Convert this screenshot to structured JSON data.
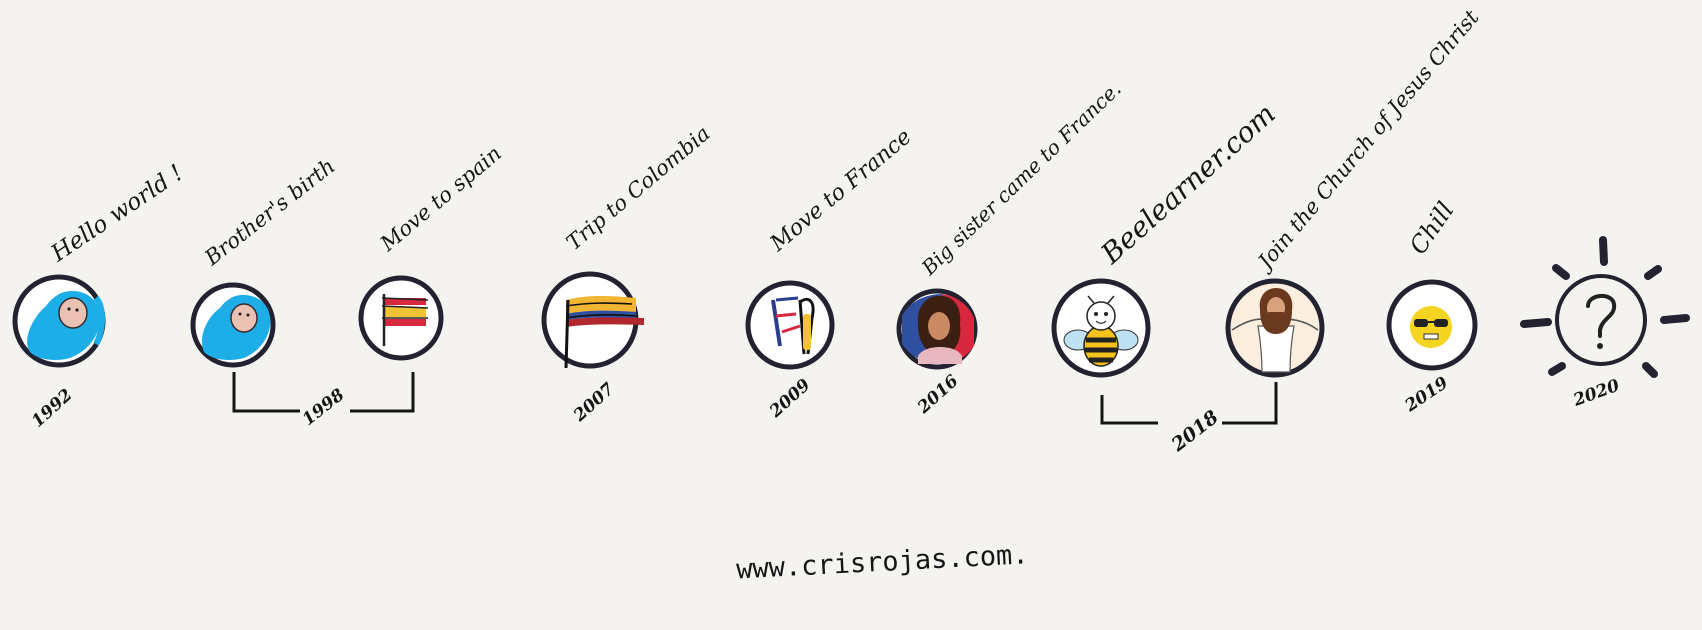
{
  "events": [
    {
      "id": "hello",
      "label": "Hello world !",
      "year": "1992",
      "icon": "baby-icon"
    },
    {
      "id": "brother",
      "label": "Brother's birth",
      "icon": "baby-icon"
    },
    {
      "id": "spain",
      "label": "Move to spain",
      "icon": "spain-flag-icon"
    },
    {
      "id": "colombia",
      "label": "Trip to Colombia",
      "year": "2007",
      "icon": "colombia-flag-icon"
    },
    {
      "id": "france",
      "label": "Move to France",
      "year": "2009",
      "icon": "france-flag-icon"
    },
    {
      "id": "sister",
      "label": "Big sister came to France.",
      "year": "2016",
      "icon": "girl-portrait-icon"
    },
    {
      "id": "beelearner",
      "label": "Beelearner.com",
      "icon": "bee-icon"
    },
    {
      "id": "church",
      "label": "Join the Church of Jesus Christ",
      "icon": "jesus-icon"
    },
    {
      "id": "chill",
      "label": "Chill",
      "year": "2019",
      "icon": "sunglasses-emoji-icon"
    },
    {
      "id": "future",
      "year": "2020",
      "icon": "question-sun-icon"
    }
  ],
  "brackets": [
    {
      "id": "b1998",
      "year": "1998"
    },
    {
      "id": "b2018",
      "year": "2018"
    }
  ],
  "website": "www.crisrojas.com."
}
